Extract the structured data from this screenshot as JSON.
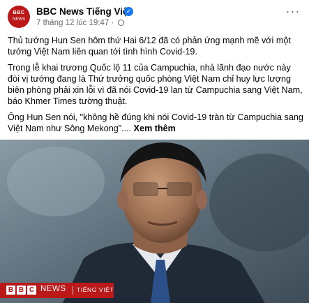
{
  "post": {
    "page_name": "BBC News Tiếng Việt",
    "avatar": {
      "top": "BBC",
      "bottom": "NEWS"
    },
    "timestamp": "7 tháng 12 lúc 19:47",
    "more_label": "···",
    "paragraphs": [
      "Thủ tướng Hun Sen hôm thứ Hai 6/12 đã có phản ứng mạnh mẽ với một tướng Việt Nam liên quan tới tình hình Covid-19.",
      "Trong lễ khai trương Quốc lộ 11 của Campuchia, nhà lãnh đạo nước này đòi vị tướng đang là Thứ trưởng quốc phòng Việt Nam chỉ huy lực lượng biên phòng phải xin lỗi vì đã nói Covid-19 lan từ Campuchia sang Việt Nam, báo Khmer Times tường thuật.",
      "Ông Hun Sen nói, \"không hề đúng khi nói Covid-19 tràn từ Campuchia sang Việt Nam như Sông Mekong\"...."
    ],
    "see_more": " Xem thêm"
  },
  "media": {
    "overlay": {
      "b1": "B",
      "b2": "B",
      "b3": "C",
      "news": "NEWS",
      "sub": "TIẾNG VIỆT"
    },
    "brand_color": "#bb1919"
  },
  "colors": {
    "text": "#050505",
    "secondary": "#65676b",
    "verified": "#1877f2"
  }
}
